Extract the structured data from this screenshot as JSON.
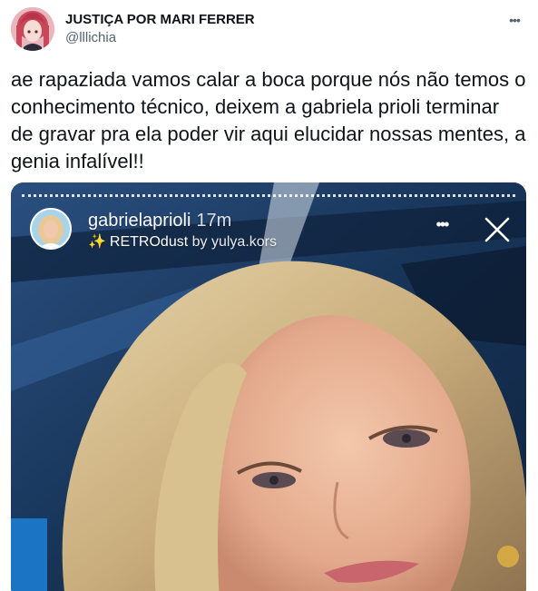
{
  "tweet": {
    "display_name": "JUSTIÇA POR MARI FERRER",
    "handle": "@lllichia",
    "more_icon": "more-horizontal-icon",
    "text": "ae rapaziada vamos calar a boca porque nós não temos o\nconhecimento técnico, deixem a gabriela prioli terminar\nde gravar pra ela poder vir aqui elucidar nossas mentes, a\ngenia infalível!!"
  },
  "story": {
    "username": "gabrielaprioli",
    "time": "17m",
    "filter_name": "RETROdust",
    "filter_by": "by yulya.kors",
    "sparkle_icon": "sparkle-icon",
    "dots_icon": "more-horizontal-icon",
    "close_icon": "close-icon"
  },
  "colors": {
    "text_primary": "#0f1419",
    "text_secondary": "#536471",
    "media_background": "#1d3b63"
  }
}
